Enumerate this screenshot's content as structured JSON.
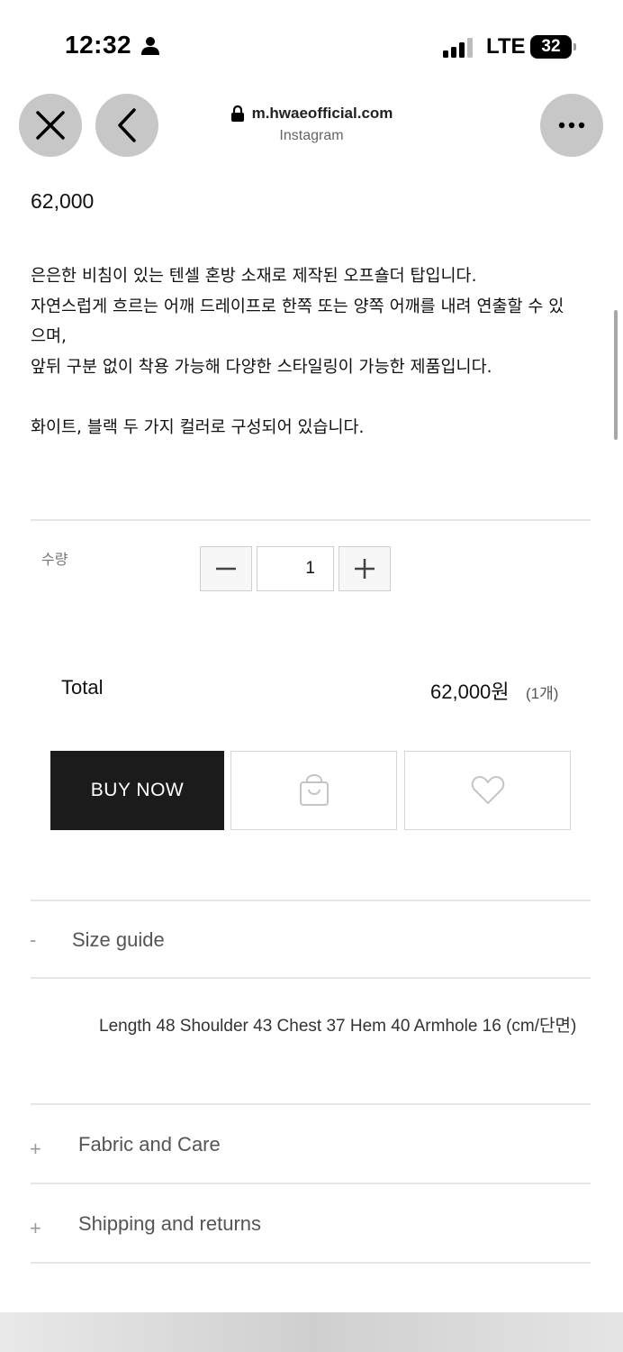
{
  "status_bar": {
    "time": "12:32",
    "network": "LTE",
    "battery": "32"
  },
  "browser": {
    "url": "m.hwaeofficial.com",
    "source": "Instagram"
  },
  "product": {
    "price": "62,000",
    "description": [
      "은은한 비침이 있는 텐셀 혼방 소재로 제작된 오프숄더 탑입니다.",
      "자연스럽게 흐르는 어깨 드레이프로 한쪽 또는 양쪽 어깨를 내려 연출할 수 있",
      "으며,",
      "앞뒤 구분 없이 착용 가능해 다양한 스타일링이 가능한 제품입니다.",
      "",
      "화이트, 블랙 두 가지 컬러로 구성되어 있습니다."
    ]
  },
  "quantity": {
    "label": "수량",
    "value": "1"
  },
  "total": {
    "label": "Total",
    "price": "62,000원",
    "count": "(1개)"
  },
  "actions": {
    "buy_now": "BUY NOW"
  },
  "accordion": {
    "size_guide": {
      "toggle": "-",
      "title": "Size guide",
      "content": "Length 48 Shoulder 43 Chest 37 Hem 40 Armhole 16 (cm/단면)"
    },
    "fabric": {
      "toggle": "+",
      "title": "Fabric and Care"
    },
    "shipping": {
      "toggle": "+",
      "title": "Shipping and returns"
    }
  },
  "icons": {
    "close": "close-icon",
    "back": "chevron-left-icon",
    "more": "ellipsis-icon",
    "lock": "lock-icon",
    "cart": "shopping-bag-icon",
    "wishlist": "heart-icon"
  }
}
